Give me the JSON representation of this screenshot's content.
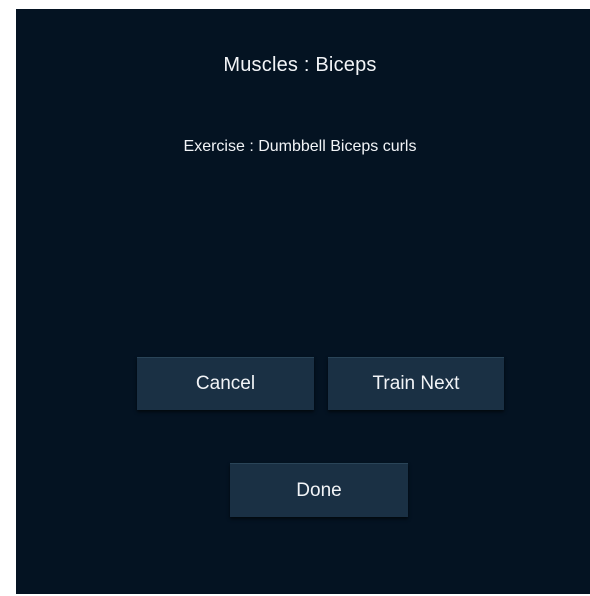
{
  "dialog": {
    "title": "Muscles : Biceps",
    "subtitle": "Exercise : Dumbbell Biceps curls"
  },
  "buttons": {
    "cancel_label": "Cancel",
    "train_next_label": "Train Next",
    "done_label": "Done"
  },
  "colors": {
    "background": "#041322",
    "button": "#1a3044",
    "text": "#f2f4f7"
  }
}
